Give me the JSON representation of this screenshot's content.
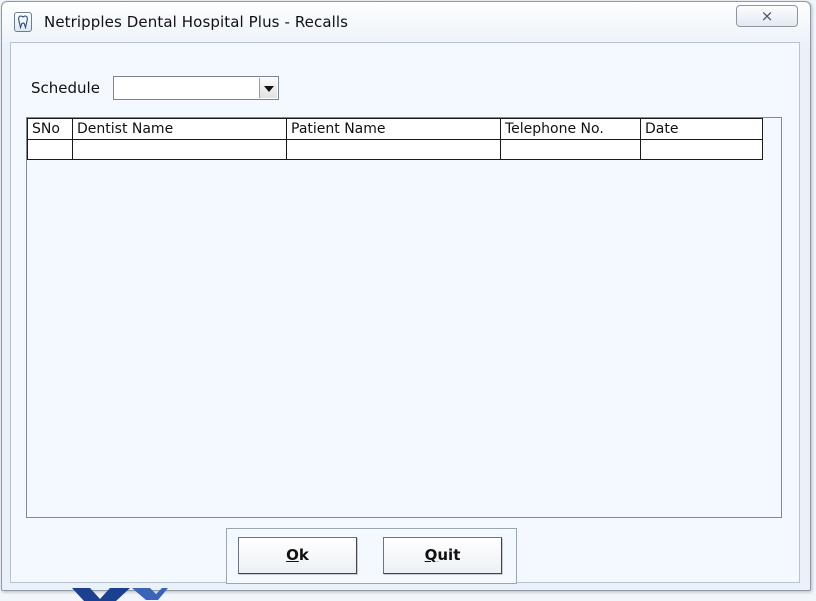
{
  "window": {
    "title": "Netripples Dental Hospital Plus - Recalls",
    "close_glyph": "×"
  },
  "filter": {
    "schedule_label": "Schedule",
    "schedule_value": ""
  },
  "grid": {
    "columns": [
      "SNo",
      "Dentist Name",
      "Patient Name",
      "Telephone No.",
      "Date"
    ],
    "rows": [
      [
        "",
        "",
        "",
        "",
        ""
      ]
    ]
  },
  "buttons": {
    "ok": {
      "mnemonic": "O",
      "rest": "k"
    },
    "quit": {
      "mnemonic": "Q",
      "rest": "uit"
    }
  },
  "icons": {
    "app": "tooth-icon",
    "close": "close-icon",
    "dropdown": "chevron-down-icon"
  }
}
